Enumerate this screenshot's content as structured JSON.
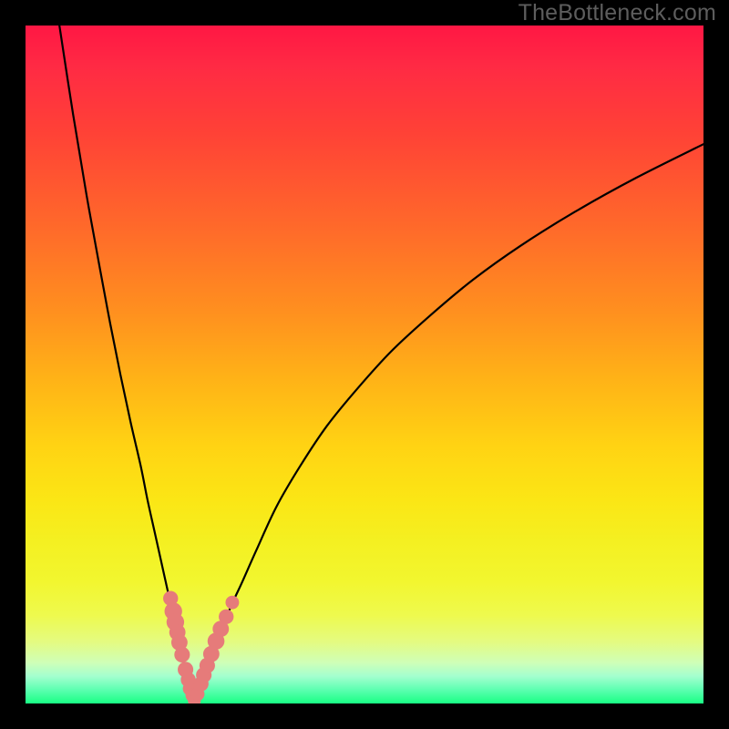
{
  "watermark": "TheBottleneck.com",
  "colors": {
    "frame": "#000000",
    "curve": "#000000",
    "dot": "#e67b7a",
    "gradient_top": "#ff1744",
    "gradient_bottom": "#19ff84"
  },
  "chart_data": {
    "type": "line",
    "title": "",
    "xlabel": "",
    "ylabel": "",
    "xlim": [
      0,
      100
    ],
    "ylim": [
      0,
      100
    ],
    "grid": false,
    "legend": false,
    "series": [
      {
        "name": "left-curve",
        "x": [
          5,
          7,
          9,
          11,
          12.5,
          14,
          15.5,
          17,
          18,
          19,
          20,
          21,
          22,
          22.8,
          23.5,
          24.2,
          24.9
        ],
        "values": [
          100,
          87,
          75,
          64,
          56,
          48.5,
          41.5,
          35,
          30,
          25.5,
          21,
          16.5,
          12,
          8.5,
          5.5,
          2.8,
          0
        ]
      },
      {
        "name": "right-curve",
        "x": [
          24.9,
          25.9,
          27,
          28.1,
          29.3,
          30.6,
          32,
          34,
          37,
          40.5,
          44.5,
          49,
          54,
          60,
          66,
          73,
          81,
          90,
          100
        ],
        "values": [
          0,
          3,
          6,
          9,
          12,
          15,
          18,
          22.5,
          29,
          35,
          41,
          46.5,
          52,
          57.5,
          62.5,
          67.5,
          72.5,
          77.5,
          82.5
        ]
      }
    ],
    "markers": {
      "name": "highlight-dots",
      "points": [
        {
          "x": 21.4,
          "y": 15.5,
          "r": 1.1
        },
        {
          "x": 21.8,
          "y": 13.6,
          "r": 1.3
        },
        {
          "x": 22.1,
          "y": 12.0,
          "r": 1.3
        },
        {
          "x": 22.4,
          "y": 10.5,
          "r": 1.2
        },
        {
          "x": 22.7,
          "y": 9.0,
          "r": 1.2
        },
        {
          "x": 23.1,
          "y": 7.2,
          "r": 1.15
        },
        {
          "x": 23.6,
          "y": 5.0,
          "r": 1.15
        },
        {
          "x": 24.0,
          "y": 3.5,
          "r": 1.1
        },
        {
          "x": 24.3,
          "y": 2.2,
          "r": 1.1
        },
        {
          "x": 24.6,
          "y": 1.2,
          "r": 1.0
        },
        {
          "x": 24.9,
          "y": 0.4,
          "r": 0.95
        },
        {
          "x": 25.4,
          "y": 1.4,
          "r": 1.0
        },
        {
          "x": 25.9,
          "y": 2.9,
          "r": 1.1
        },
        {
          "x": 26.3,
          "y": 4.2,
          "r": 1.15
        },
        {
          "x": 26.8,
          "y": 5.6,
          "r": 1.15
        },
        {
          "x": 27.4,
          "y": 7.3,
          "r": 1.2
        },
        {
          "x": 28.1,
          "y": 9.2,
          "r": 1.25
        },
        {
          "x": 28.8,
          "y": 11.0,
          "r": 1.2
        },
        {
          "x": 29.6,
          "y": 12.8,
          "r": 1.1
        },
        {
          "x": 30.5,
          "y": 14.9,
          "r": 1.0
        }
      ]
    }
  }
}
